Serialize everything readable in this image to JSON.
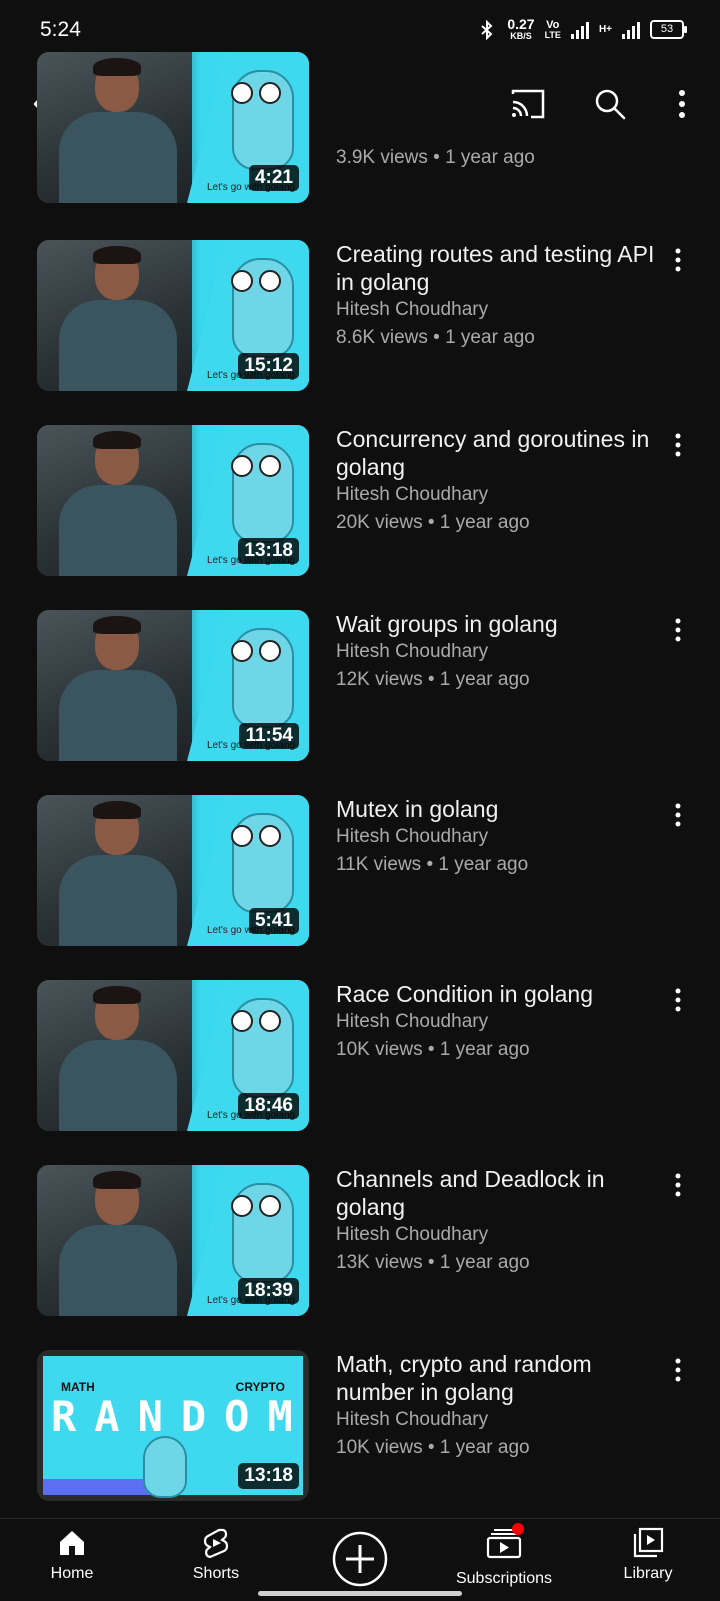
{
  "status": {
    "time": "5:24",
    "data_rate": "0.27",
    "data_unit": "KB/S",
    "volte_top": "Vo",
    "volte_bottom": "LTE",
    "network": "H+",
    "battery": "53"
  },
  "appbar": {
    "back_icon": "arrow-left-icon",
    "cast_icon": "cast-icon",
    "search_icon": "search-icon",
    "menu_icon": "more-vert-icon"
  },
  "videos": [
    {
      "title": "",
      "channel": "",
      "stats": "3.9K views • 1 year ago",
      "duration": "4:21",
      "caption": "Let's go with golang"
    },
    {
      "title": "Creating routes and testing API in golang",
      "channel": "Hitesh Choudhary",
      "stats": "8.6K views • 1 year ago",
      "duration": "15:12",
      "caption": "Let's go with golang"
    },
    {
      "title": "Concurrency and goroutines in golang",
      "channel": "Hitesh Choudhary",
      "stats": "20K views • 1 year ago",
      "duration": "13:18",
      "caption": "Let's go with golang"
    },
    {
      "title": "Wait groups in golang",
      "channel": "Hitesh Choudhary",
      "stats": "12K views • 1 year ago",
      "duration": "11:54",
      "caption": "Let's go with golang"
    },
    {
      "title": "Mutex in golang",
      "channel": "Hitesh Choudhary",
      "stats": "11K views • 1 year ago",
      "duration": "5:41",
      "caption": "Let's go with golang"
    },
    {
      "title": "Race Condition in golang",
      "channel": "Hitesh Choudhary",
      "stats": "10K views • 1 year ago",
      "duration": "18:46",
      "caption": "Let's go with golang"
    },
    {
      "title": "Channels and Deadlock in golang",
      "channel": "Hitesh Choudhary",
      "stats": "13K views • 1 year ago",
      "duration": "18:39",
      "caption": "Let's go with golang"
    },
    {
      "title": "Math, crypto and random number in golang",
      "channel": "Hitesh Choudhary",
      "stats": "10K views • 1 year ago",
      "duration": "13:18",
      "thumb_word": "RANDOM",
      "thumb_left": "MATH",
      "thumb_right": "CRYPTO"
    }
  ],
  "bottom_nav": [
    {
      "label": "Home",
      "icon": "home-icon"
    },
    {
      "label": "Shorts",
      "icon": "shorts-icon"
    },
    {
      "label": "",
      "icon": "create-icon"
    },
    {
      "label": "Subscriptions",
      "icon": "subscriptions-icon"
    },
    {
      "label": "Library",
      "icon": "library-icon"
    }
  ],
  "colors": {
    "background": "#0f0f0f",
    "accent": "#ff0000",
    "secondary_text": "#aaaaaa"
  }
}
